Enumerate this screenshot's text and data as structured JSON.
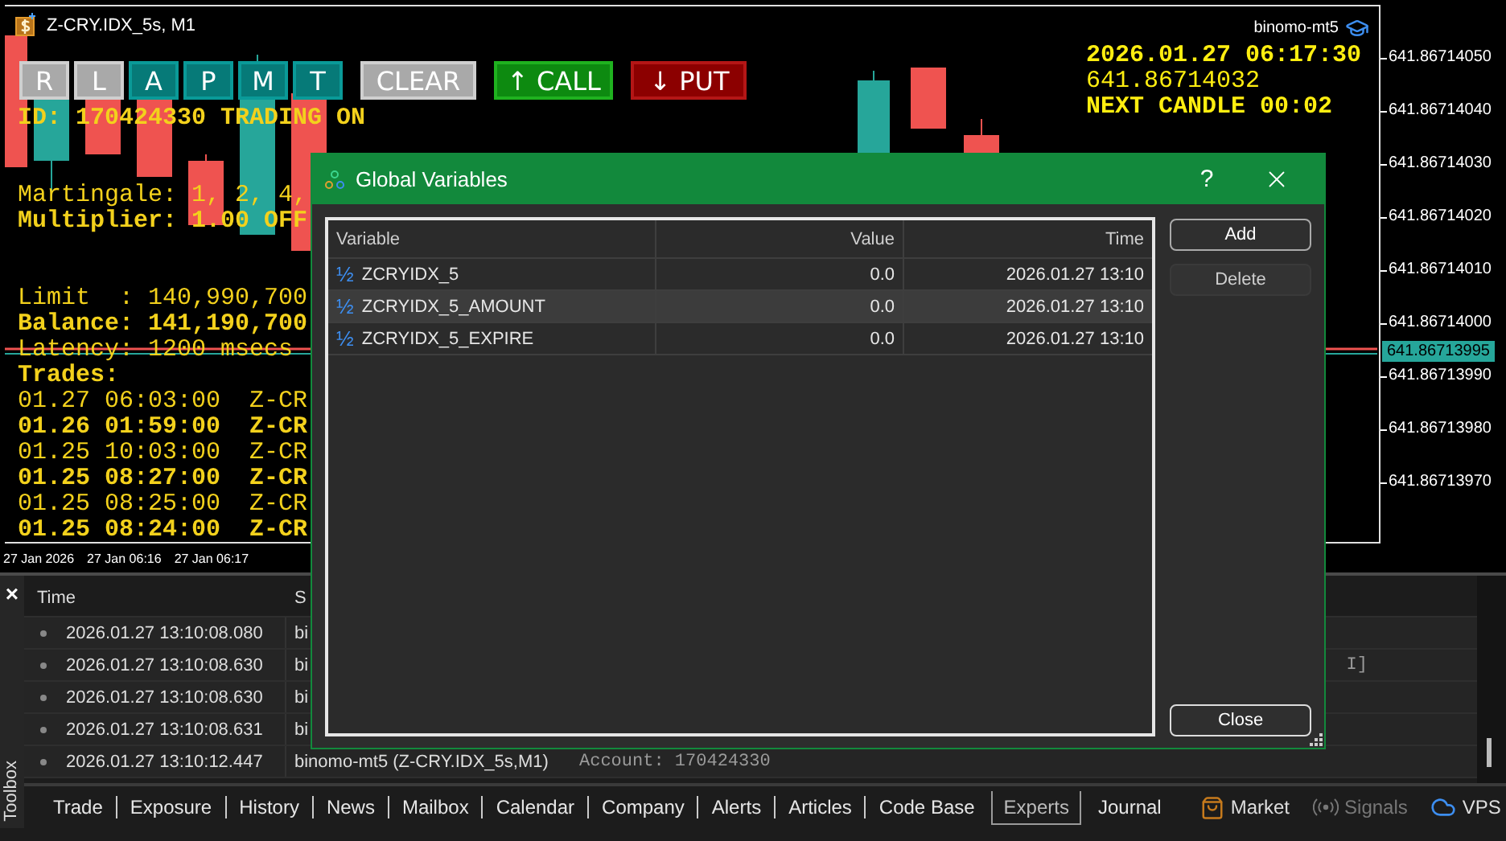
{
  "chart": {
    "title": "Z-CRY.IDX_5s, M1",
    "account": "binomo-mt5",
    "buttons": [
      {
        "label": "R",
        "kind": "toggle",
        "on": false
      },
      {
        "label": "L",
        "kind": "toggle",
        "on": false
      },
      {
        "label": "A",
        "kind": "toggle",
        "on": true
      },
      {
        "label": "P",
        "kind": "toggle",
        "on": true
      },
      {
        "label": "M",
        "kind": "toggle",
        "on": true
      },
      {
        "label": "T",
        "kind": "toggle",
        "on": true
      },
      {
        "label": "CLEAR",
        "kind": "clear"
      },
      {
        "label": "↑ CALL",
        "kind": "call"
      },
      {
        "label": "↓ PUT",
        "kind": "put"
      }
    ],
    "status": "ID: 170424330 TRADING ON",
    "settings": [
      {
        "text": "Martingale: 1, 2, 4,",
        "bold": false
      },
      {
        "text": "Multiplier: 1.00 OFF",
        "bold": true
      }
    ],
    "account_lines": [
      {
        "text": "Limit  : 140,990,700",
        "bold": false
      },
      {
        "text": "Balance: 141,190,700",
        "bold": true
      },
      {
        "text": "Latency: 1200 msecs",
        "bold": false
      }
    ],
    "trades_label": "Trades:",
    "trades": [
      {
        "text": "01.27 06:03:00  Z-CR",
        "bold": false
      },
      {
        "text": "01.26 01:59:00  Z-CR",
        "bold": true
      },
      {
        "text": "01.25 10:03:00  Z-CR",
        "bold": false
      },
      {
        "text": "01.25 08:27:00  Z-CR",
        "bold": true
      },
      {
        "text": "01.25 08:25:00  Z-CR",
        "bold": false
      },
      {
        "text": "01.25 08:24:00  Z-CR",
        "bold": true
      }
    ],
    "clock": "2026.01.27 06:17:30",
    "price": "641.86714032",
    "next_candle": "NEXT CANDLE 00:02",
    "price_ticks": [
      "641.86714050",
      "641.86714040",
      "641.86714030",
      "641.86714020",
      "641.86714010",
      "641.86714000",
      "641.86713990",
      "641.86713980",
      "641.86713970"
    ],
    "current_price": "641.86713995",
    "time_labels": [
      "27 Jan 2026",
      "27 Jan 06:16",
      "27 Jan 06:17"
    ]
  },
  "toolbox": {
    "close": "×",
    "label": "Toolbox"
  },
  "journal": {
    "columns": [
      "Time",
      "S"
    ],
    "rows": [
      {
        "time": "2026.01.27 13:10:08.080",
        "source": "bi"
      },
      {
        "time": "2026.01.27 13:10:08.630",
        "source": "bi",
        "message_tail": "I]"
      },
      {
        "time": "2026.01.27 13:10:08.630",
        "source": "bi"
      },
      {
        "time": "2026.01.27 13:10:08.631",
        "source": "bi"
      },
      {
        "time": "2026.01.27 13:10:12.447",
        "source": "binomo-mt5 (Z-CRY.IDX_5s,M1)",
        "message": "Account: 170424330"
      }
    ]
  },
  "tabs": [
    {
      "label": "Trade",
      "selected": false
    },
    {
      "label": "Exposure",
      "selected": false
    },
    {
      "label": "History",
      "selected": false
    },
    {
      "label": "News",
      "selected": false
    },
    {
      "label": "Mailbox",
      "selected": false
    },
    {
      "label": "Calendar",
      "selected": false
    },
    {
      "label": "Company",
      "selected": false
    },
    {
      "label": "Alerts",
      "selected": false
    },
    {
      "label": "Articles",
      "selected": false
    },
    {
      "label": "Code Base",
      "selected": false
    },
    {
      "label": "Experts",
      "selected": true
    },
    {
      "label": "Journal",
      "selected": false
    }
  ],
  "side_links": [
    {
      "label": "Market",
      "kind": "market",
      "disabled": false
    },
    {
      "label": "Signals",
      "kind": "signals",
      "disabled": true
    },
    {
      "label": "VPS",
      "kind": "vps",
      "disabled": false
    }
  ],
  "dialog": {
    "title": "Global Variables",
    "help": "?",
    "columns": [
      "Variable",
      "Value",
      "Time"
    ],
    "rows": [
      {
        "icon": "½",
        "variable": "ZCRYIDX_5",
        "value": "0.0",
        "time": "2026.01.27 13:10",
        "selected": false
      },
      {
        "icon": "½",
        "variable": "ZCRYIDX_5_AMOUNT",
        "value": "0.0",
        "time": "2026.01.27 13:10",
        "selected": true
      },
      {
        "icon": "½",
        "variable": "ZCRYIDX_5_EXPIRE",
        "value": "0.0",
        "time": "2026.01.27 13:10",
        "selected": false
      }
    ],
    "buttons": [
      {
        "label": "Add",
        "disabled": false
      },
      {
        "label": "Delete",
        "disabled": true
      }
    ],
    "close_label": "Close"
  }
}
